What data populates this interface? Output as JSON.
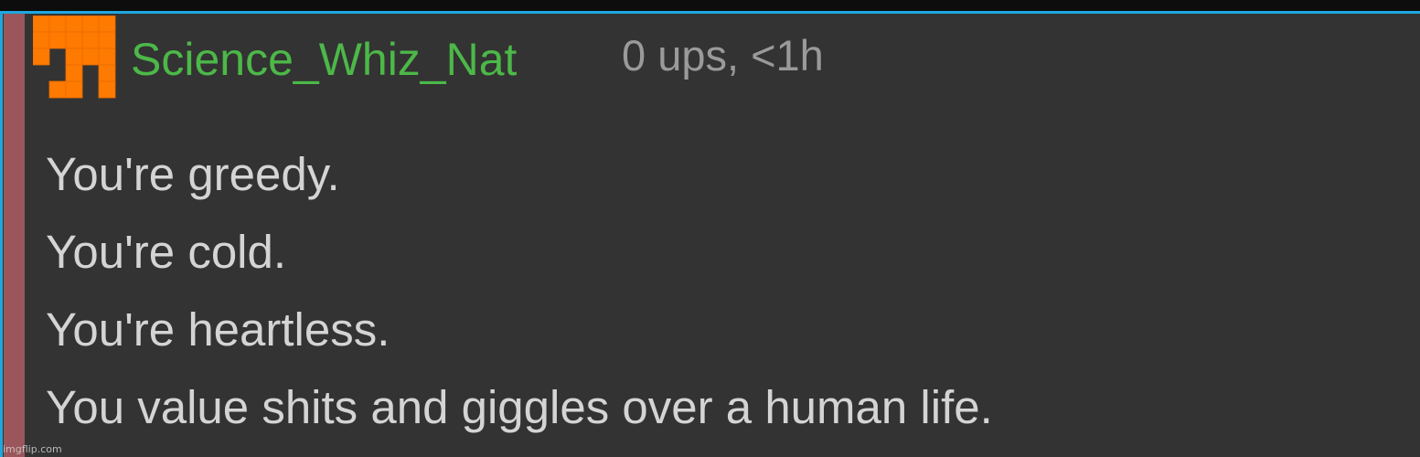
{
  "comment": {
    "author": "Science_Whiz_Nat",
    "meta": "0 ups, <1h",
    "lines": [
      "You're greedy.",
      "You're cold.",
      "You're heartless.",
      "You value shits and giggles over a human life."
    ]
  },
  "avatar": {
    "icon": "pixel-avatar-icon",
    "color": "#ff7a00"
  },
  "colors": {
    "author": "#4cb848",
    "accent_border": "#1fa7e0",
    "depth_bar": "#9b565b",
    "background": "#333333"
  },
  "watermark": "imgflip.com"
}
